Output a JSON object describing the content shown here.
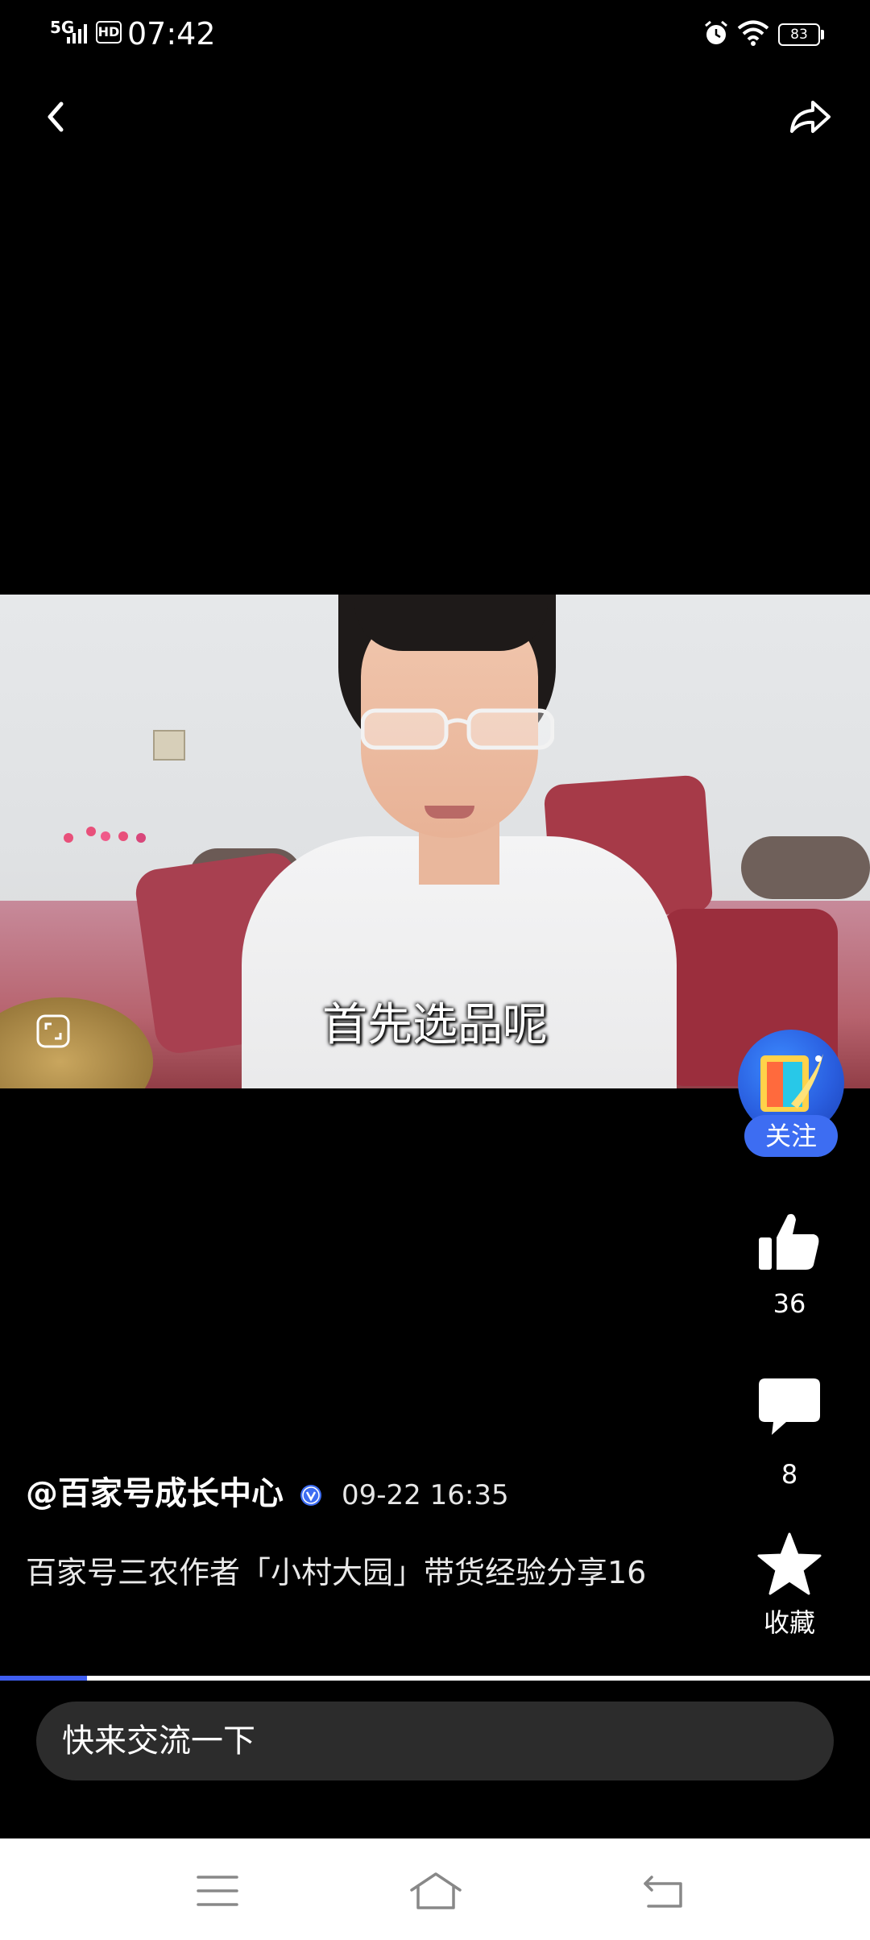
{
  "status_bar": {
    "network": "5G",
    "hd": "HD",
    "time": "07:42",
    "battery": "83"
  },
  "video": {
    "subtitle": "首先选品呢",
    "progress_fraction": 0.1
  },
  "actions": {
    "follow_label": "关注",
    "like_count": "36",
    "comment_count": "8",
    "favorite_label": "收藏"
  },
  "post": {
    "author": "@百家号成长中心",
    "time": "09-22 16:35",
    "title": "百家号三农作者「小村大园」带货经验分享16"
  },
  "comment_box": {
    "placeholder": "快来交流一下"
  },
  "colors": {
    "accent": "#3d6df2",
    "progress": "#3f5ef0",
    "input_bg": "#2c2c2c"
  },
  "icons": {
    "back": "chevron-left-icon",
    "share": "share-arrow-icon",
    "like": "thumbs-up-icon",
    "comment": "speech-bubble-icon",
    "favorite": "star-icon",
    "verified": "verified-badge-icon",
    "fullscreen": "fullscreen-icon"
  }
}
